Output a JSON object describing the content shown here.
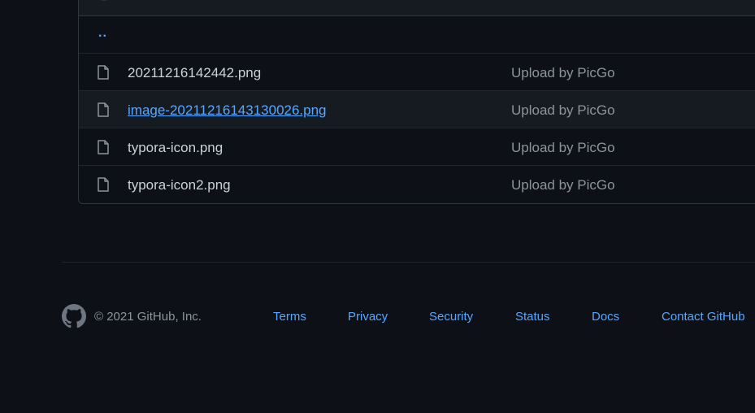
{
  "file_list": {
    "parent_dir": "..",
    "files": [
      {
        "name": "20211216142442.png",
        "commit": "Upload by PicGo",
        "hovered": false
      },
      {
        "name": "image-20211216143130026.png",
        "commit": "Upload by PicGo",
        "hovered": true
      },
      {
        "name": "typora-icon.png",
        "commit": "Upload by PicGo",
        "hovered": false
      },
      {
        "name": "typora-icon2.png",
        "commit": "Upload by PicGo",
        "hovered": false
      }
    ]
  },
  "footer": {
    "copyright": "© 2021 GitHub, Inc.",
    "links": [
      {
        "label": "Terms"
      },
      {
        "label": "Privacy"
      },
      {
        "label": "Security"
      },
      {
        "label": "Status"
      },
      {
        "label": "Docs"
      },
      {
        "label": "Contact GitHub"
      }
    ]
  },
  "colors": {
    "background": "#0d1117",
    "link": "#58a6ff",
    "text": "#c9d1d9",
    "muted": "#8b949e"
  },
  "icons": {
    "file": "file-icon",
    "logo": "github-logo-icon"
  }
}
